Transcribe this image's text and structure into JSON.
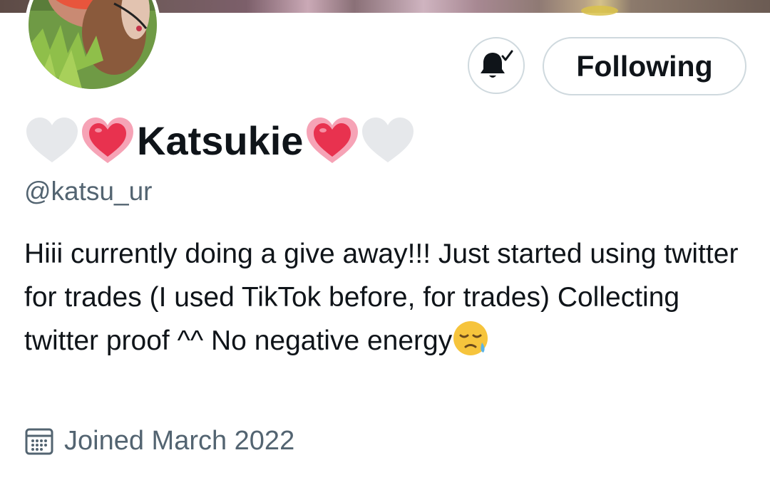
{
  "profile": {
    "display_name": "Katsukie",
    "handle": "@katsu_ur",
    "bio_text": "Hiii currently doing a give away!!! Just started using twitter for trades (I used TikTok before, for trades) Collecting twitter proof ^^ No negative energy",
    "bio_trailing_emoji": "sleepy-face-emoji",
    "name_decorations": [
      "white-heart-icon",
      "glowing-heart-icon",
      "glowing-heart-icon",
      "white-heart-icon"
    ],
    "joined_label": "Joined March 2022"
  },
  "actions": {
    "notifications_icon": "bell-check-icon",
    "follow_label": "Following"
  },
  "colors": {
    "text_primary": "#0f1419",
    "text_secondary": "#536471",
    "button_border": "#cfd9de",
    "heart_pink": "#f06a8a",
    "heart_red": "#e8324f",
    "heart_white": "#e6e8eb"
  }
}
